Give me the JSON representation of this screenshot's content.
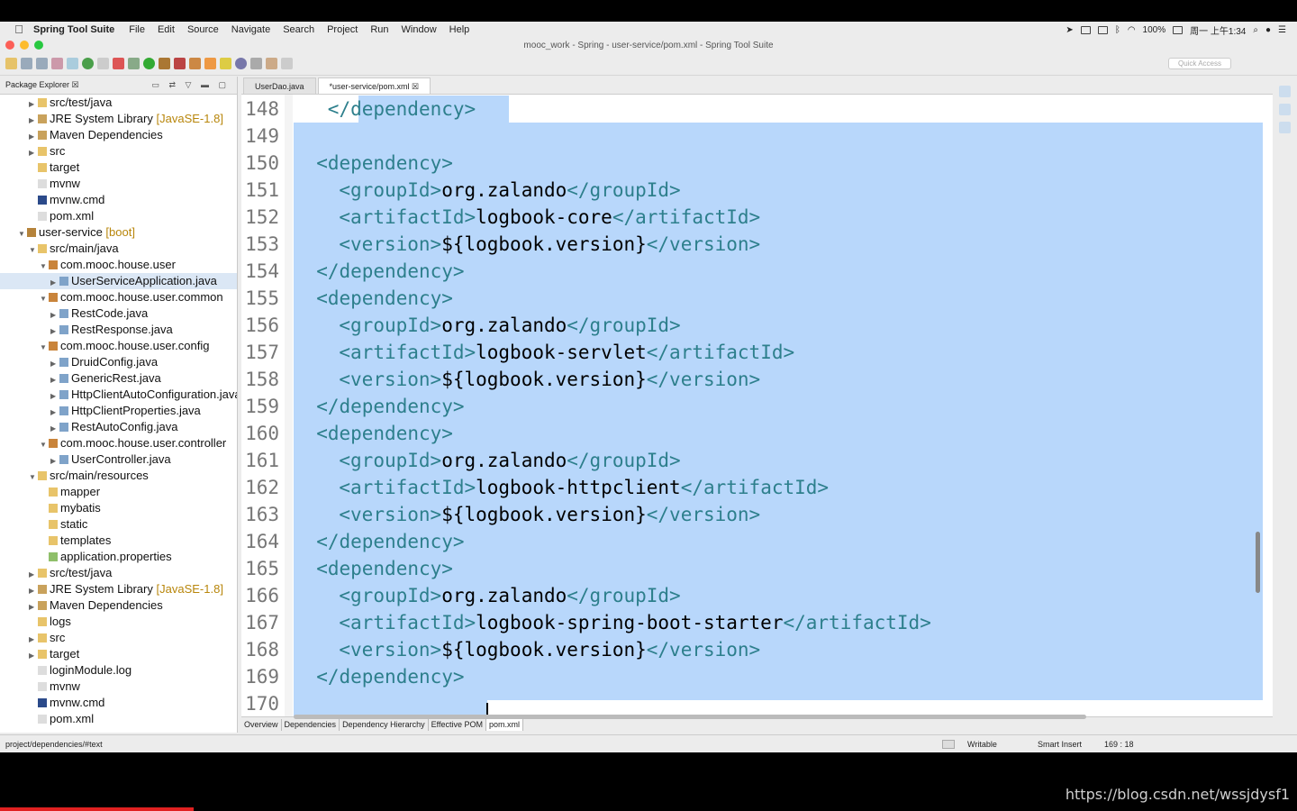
{
  "menubar": {
    "app": "Spring Tool Suite",
    "items": [
      "File",
      "Edit",
      "Source",
      "Navigate",
      "Search",
      "Project",
      "Run",
      "Window",
      "Help"
    ],
    "battery": "100%",
    "clock": "周一 上午1:34"
  },
  "window": {
    "title": "mooc_work - Spring - user-service/pom.xml - Spring Tool Suite",
    "quick_access": "Quick Access"
  },
  "package_explorer": {
    "title": "Package Explorer ☒",
    "rows": [
      {
        "indent": 2,
        "arrow": "▶",
        "icon": "folder",
        "label": "src/test/java",
        "deco": ""
      },
      {
        "indent": 2,
        "arrow": "▶",
        "icon": "lib",
        "label": "JRE System Library",
        "deco": "[JavaSE-1.8]"
      },
      {
        "indent": 2,
        "arrow": "▶",
        "icon": "lib",
        "label": "Maven Dependencies",
        "deco": ""
      },
      {
        "indent": 2,
        "arrow": "▶",
        "icon": "folder",
        "label": "src",
        "deco": ""
      },
      {
        "indent": 2,
        "arrow": "",
        "icon": "folder",
        "label": "target",
        "deco": ""
      },
      {
        "indent": 2,
        "arrow": "",
        "icon": "file",
        "label": "mvnw",
        "deco": ""
      },
      {
        "indent": 2,
        "arrow": "",
        "icon": "cmd",
        "label": "mvnw.cmd",
        "deco": ""
      },
      {
        "indent": 2,
        "arrow": "",
        "icon": "file",
        "label": "pom.xml",
        "deco": ""
      },
      {
        "indent": 1,
        "arrow": "▼",
        "icon": "project",
        "label": "user-service",
        "deco": "[boot]"
      },
      {
        "indent": 2,
        "arrow": "▼",
        "icon": "folder",
        "label": "src/main/java",
        "deco": ""
      },
      {
        "indent": 3,
        "arrow": "▼",
        "icon": "pkg",
        "label": "com.mooc.house.user",
        "deco": ""
      },
      {
        "indent": 4,
        "arrow": "▶",
        "icon": "java",
        "label": "UserServiceApplication.java",
        "deco": "",
        "selected": true
      },
      {
        "indent": 3,
        "arrow": "▼",
        "icon": "pkg",
        "label": "com.mooc.house.user.common",
        "deco": ""
      },
      {
        "indent": 4,
        "arrow": "▶",
        "icon": "java",
        "label": "RestCode.java",
        "deco": ""
      },
      {
        "indent": 4,
        "arrow": "▶",
        "icon": "java",
        "label": "RestResponse.java",
        "deco": ""
      },
      {
        "indent": 3,
        "arrow": "▼",
        "icon": "pkg",
        "label": "com.mooc.house.user.config",
        "deco": ""
      },
      {
        "indent": 4,
        "arrow": "▶",
        "icon": "java",
        "label": "DruidConfig.java",
        "deco": ""
      },
      {
        "indent": 4,
        "arrow": "▶",
        "icon": "java",
        "label": "GenericRest.java",
        "deco": ""
      },
      {
        "indent": 4,
        "arrow": "▶",
        "icon": "java",
        "label": "HttpClientAutoConfiguration.java",
        "deco": ""
      },
      {
        "indent": 4,
        "arrow": "▶",
        "icon": "java",
        "label": "HttpClientProperties.java",
        "deco": ""
      },
      {
        "indent": 4,
        "arrow": "▶",
        "icon": "java",
        "label": "RestAutoConfig.java",
        "deco": ""
      },
      {
        "indent": 3,
        "arrow": "▼",
        "icon": "pkg",
        "label": "com.mooc.house.user.controller",
        "deco": ""
      },
      {
        "indent": 4,
        "arrow": "▶",
        "icon": "java",
        "label": "UserController.java",
        "deco": ""
      },
      {
        "indent": 2,
        "arrow": "▼",
        "icon": "folder",
        "label": "src/main/resources",
        "deco": ""
      },
      {
        "indent": 3,
        "arrow": "",
        "icon": "folder",
        "label": "mapper",
        "deco": ""
      },
      {
        "indent": 3,
        "arrow": "",
        "icon": "folder",
        "label": "mybatis",
        "deco": ""
      },
      {
        "indent": 3,
        "arrow": "",
        "icon": "folder",
        "label": "static",
        "deco": ""
      },
      {
        "indent": 3,
        "arrow": "",
        "icon": "folder",
        "label": "templates",
        "deco": ""
      },
      {
        "indent": 3,
        "arrow": "",
        "icon": "prop",
        "label": "application.properties",
        "deco": ""
      },
      {
        "indent": 2,
        "arrow": "▶",
        "icon": "folder",
        "label": "src/test/java",
        "deco": ""
      },
      {
        "indent": 2,
        "arrow": "▶",
        "icon": "lib",
        "label": "JRE System Library",
        "deco": "[JavaSE-1.8]"
      },
      {
        "indent": 2,
        "arrow": "▶",
        "icon": "lib",
        "label": "Maven Dependencies",
        "deco": ""
      },
      {
        "indent": 2,
        "arrow": "",
        "icon": "folder",
        "label": "logs",
        "deco": ""
      },
      {
        "indent": 2,
        "arrow": "▶",
        "icon": "folder",
        "label": "src",
        "deco": ""
      },
      {
        "indent": 2,
        "arrow": "▶",
        "icon": "folder",
        "label": "target",
        "deco": ""
      },
      {
        "indent": 2,
        "arrow": "",
        "icon": "file",
        "label": "loginModule.log",
        "deco": ""
      },
      {
        "indent": 2,
        "arrow": "",
        "icon": "file",
        "label": "mvnw",
        "deco": ""
      },
      {
        "indent": 2,
        "arrow": "",
        "icon": "cmd",
        "label": "mvnw.cmd",
        "deco": ""
      },
      {
        "indent": 2,
        "arrow": "",
        "icon": "file",
        "label": "pom.xml",
        "deco": ""
      }
    ]
  },
  "editor": {
    "tabs": [
      {
        "label": "UserDao.java",
        "active": false
      },
      {
        "label": "*user-service/pom.xml ☒",
        "active": true
      }
    ],
    "lines": [
      {
        "n": "148",
        "indent": 3,
        "tag": "</dependency>"
      },
      {
        "n": "149",
        "indent": 0,
        "tag": ""
      },
      {
        "n": "150",
        "indent": 2,
        "tag": "<dependency>"
      },
      {
        "n": "151",
        "indent": 4,
        "open": "<groupId>",
        "text": "org.zalando",
        "close": "</groupId>"
      },
      {
        "n": "152",
        "indent": 4,
        "open": "<artifactId>",
        "text": "logbook-core",
        "close": "</artifactId>"
      },
      {
        "n": "153",
        "indent": 4,
        "open": "<version>",
        "text": "${logbook.version}",
        "close": "</version>"
      },
      {
        "n": "154",
        "indent": 2,
        "tag": "</dependency>"
      },
      {
        "n": "155",
        "indent": 2,
        "tag": "<dependency>"
      },
      {
        "n": "156",
        "indent": 4,
        "open": "<groupId>",
        "text": "org.zalando",
        "close": "</groupId>"
      },
      {
        "n": "157",
        "indent": 4,
        "open": "<artifactId>",
        "text": "logbook-servlet",
        "close": "</artifactId>"
      },
      {
        "n": "158",
        "indent": 4,
        "open": "<version>",
        "text": "${logbook.version}",
        "close": "</version>"
      },
      {
        "n": "159",
        "indent": 2,
        "tag": "</dependency>"
      },
      {
        "n": "160",
        "indent": 2,
        "tag": "<dependency>"
      },
      {
        "n": "161",
        "indent": 4,
        "open": "<groupId>",
        "text": "org.zalando",
        "close": "</groupId>"
      },
      {
        "n": "162",
        "indent": 4,
        "open": "<artifactId>",
        "text": "logbook-httpclient",
        "close": "</artifactId>"
      },
      {
        "n": "163",
        "indent": 4,
        "open": "<version>",
        "text": "${logbook.version}",
        "close": "</version>"
      },
      {
        "n": "164",
        "indent": 2,
        "tag": "</dependency>"
      },
      {
        "n": "165",
        "indent": 2,
        "tag": "<dependency>"
      },
      {
        "n": "166",
        "indent": 4,
        "open": "<groupId>",
        "text": "org.zalando",
        "close": "</groupId>"
      },
      {
        "n": "167",
        "indent": 4,
        "open": "<artifactId>",
        "text": "logbook-spring-boot-starter",
        "close": "</artifactId>"
      },
      {
        "n": "168",
        "indent": 4,
        "open": "<version>",
        "text": "${logbook.version}",
        "close": "</version>"
      },
      {
        "n": "169",
        "indent": 2,
        "tag": "</dependency>"
      },
      {
        "n": "170",
        "indent": 0,
        "tag": ""
      }
    ],
    "bottom_tabs": [
      {
        "label": "Overview",
        "active": false
      },
      {
        "label": "Dependencies",
        "active": false
      },
      {
        "label": "Dependency Hierarchy",
        "active": false
      },
      {
        "label": "Effective POM",
        "active": false
      },
      {
        "label": "pom.xml",
        "active": true
      }
    ]
  },
  "status": {
    "path": "project/dependencies/#text",
    "writable": "Writable",
    "insert": "Smart Insert",
    "position": "169 : 18"
  },
  "watermark": "https://blog.csdn.net/wssjdysf1",
  "colors": {
    "selection": "#b8d7fb",
    "tag": "#2d7f8c",
    "tree_selected": "#dbe7f5"
  }
}
